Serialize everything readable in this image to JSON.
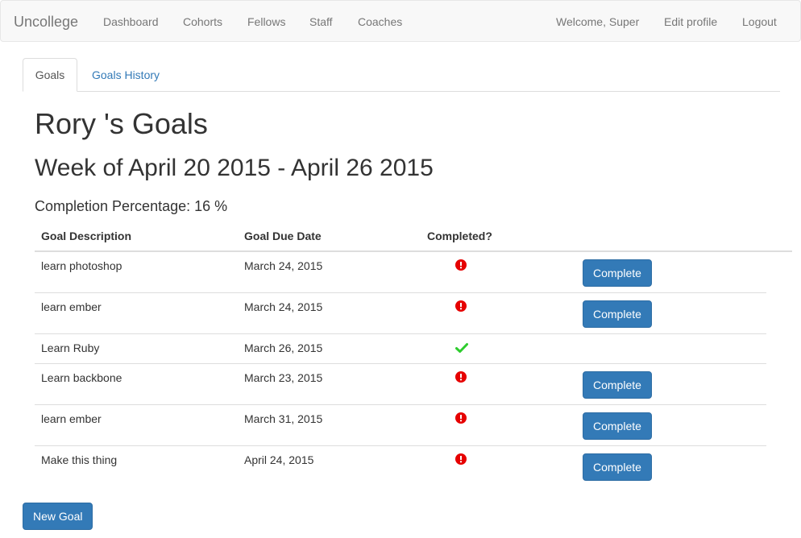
{
  "navbar": {
    "brand": "Uncollege",
    "links": [
      "Dashboard",
      "Cohorts",
      "Fellows",
      "Staff",
      "Coaches"
    ],
    "right_links": [
      "Welcome, Super",
      "Edit profile",
      "Logout"
    ]
  },
  "tabs": [
    "Goals",
    "Goals History"
  ],
  "page": {
    "title": "Rory 's Goals",
    "week": "Week of April 20 2015 - April 26 2015",
    "completion": "Completion Percentage: 16 %"
  },
  "table": {
    "headers": [
      "Goal Description",
      "Goal Due Date",
      "Completed?"
    ],
    "rows": [
      {
        "description": "learn photoshop",
        "due": "March 24, 2015",
        "completed": false,
        "action": "Complete"
      },
      {
        "description": "learn ember",
        "due": "March 24, 2015",
        "completed": false,
        "action": "Complete"
      },
      {
        "description": "Learn Ruby",
        "due": "March 26, 2015",
        "completed": true,
        "action": ""
      },
      {
        "description": "Learn backbone",
        "due": "March 23, 2015",
        "completed": false,
        "action": "Complete"
      },
      {
        "description": "learn ember",
        "due": "March 31, 2015",
        "completed": false,
        "action": "Complete"
      },
      {
        "description": "Make this thing",
        "due": "April 24, 2015",
        "completed": false,
        "action": "Complete"
      }
    ]
  },
  "new_goal_label": "New Goal",
  "colors": {
    "primary": "#337ab7",
    "incomplete": "#e60000",
    "complete": "#2ecc2e"
  },
  "icons": {
    "incomplete": "exclamation-circle-icon",
    "complete": "checkmark-icon"
  }
}
